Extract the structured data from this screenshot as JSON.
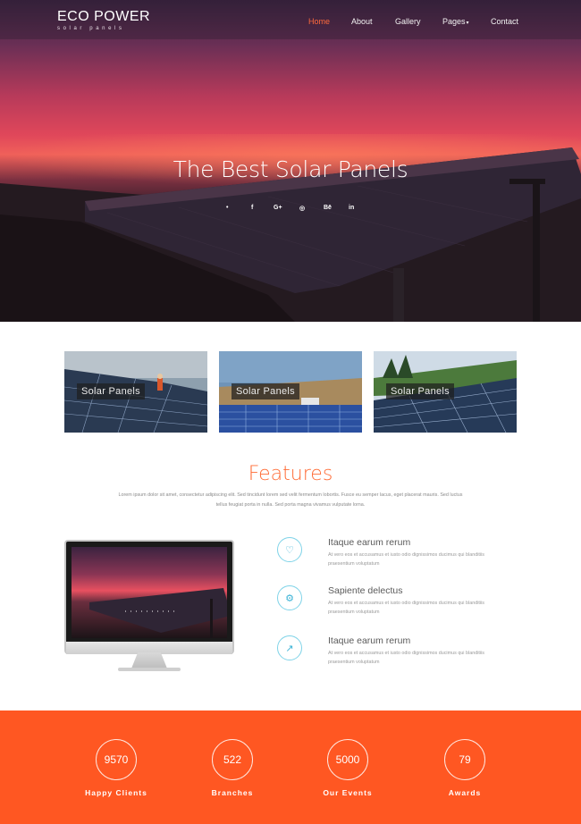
{
  "brand": {
    "title": "ECO POWER",
    "subtitle": "solar panels"
  },
  "nav": [
    {
      "label": "Home",
      "active": true
    },
    {
      "label": "About"
    },
    {
      "label": "Gallery"
    },
    {
      "label": "Pages",
      "dropdown": true
    },
    {
      "label": "Contact"
    }
  ],
  "hero": {
    "title": "The Best Solar Panels",
    "social": [
      "twitter-icon",
      "facebook-icon",
      "google-plus-icon",
      "dribbble-icon",
      "behance-icon",
      "linkedin-icon"
    ],
    "social_glyphs": [
      "•",
      "f",
      "G+",
      "◎",
      "Bē",
      "in"
    ]
  },
  "cards": [
    {
      "label": "Solar Panels"
    },
    {
      "label": "Solar Panels"
    },
    {
      "label": "Solar Panels"
    }
  ],
  "features": {
    "heading": "Features",
    "description": "Lorem ipsum dolor sit amet, consectetur adipiscing elit. Sed tincidunt lorem sed velit fermentum lobortis. Fusce eu semper lacus, eget placerat mauris. Sed luctus tellus feugiat porta in nulla. Sed porta magna vivamus vulputate lorna.",
    "items": [
      {
        "icon": "heart-icon",
        "glyph": "♡",
        "title": "Itaque earum rerum",
        "text": "At vero eos et accusamus et iusto odio dignissimos ducimus qui blanditiis praesentium voluptatum"
      },
      {
        "icon": "gears-icon",
        "glyph": "⚙",
        "title": "Sapiente delectus",
        "text": "At vero eos et accusamus et iusto odio dignissimos ducimus qui blanditiis praesentium voluptatum"
      },
      {
        "icon": "chart-line-icon",
        "glyph": "↗",
        "title": "Itaque earum rerum",
        "text": "At vero eos et accusamus et iusto odio dignissimos ducimus qui blanditiis praesentium voluptatum"
      }
    ]
  },
  "stats": [
    {
      "value": "9570",
      "label": "Happy Clients"
    },
    {
      "value": "522",
      "label": "Branches"
    },
    {
      "value": "5000",
      "label": "Our Events"
    },
    {
      "value": "79",
      "label": "Awards"
    }
  ],
  "colors": {
    "accent": "#ff5722",
    "heading": "#ff6b35",
    "nav_active": "#ff6a3c",
    "icon_ring": "#7fd3e8"
  }
}
